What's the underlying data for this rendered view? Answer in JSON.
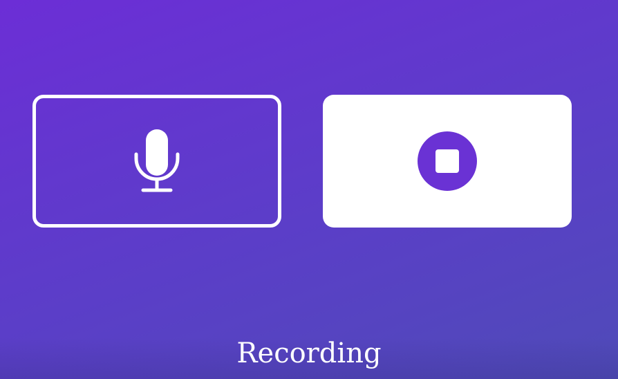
{
  "status_text": "Recording",
  "controls": {
    "mic_icon": "microphone-icon",
    "stop_icon": "stop-icon"
  },
  "colors": {
    "background_start": "#6c2ed6",
    "background_end": "#4f4bb8",
    "accent": "#6a32d4",
    "foreground": "#ffffff"
  }
}
